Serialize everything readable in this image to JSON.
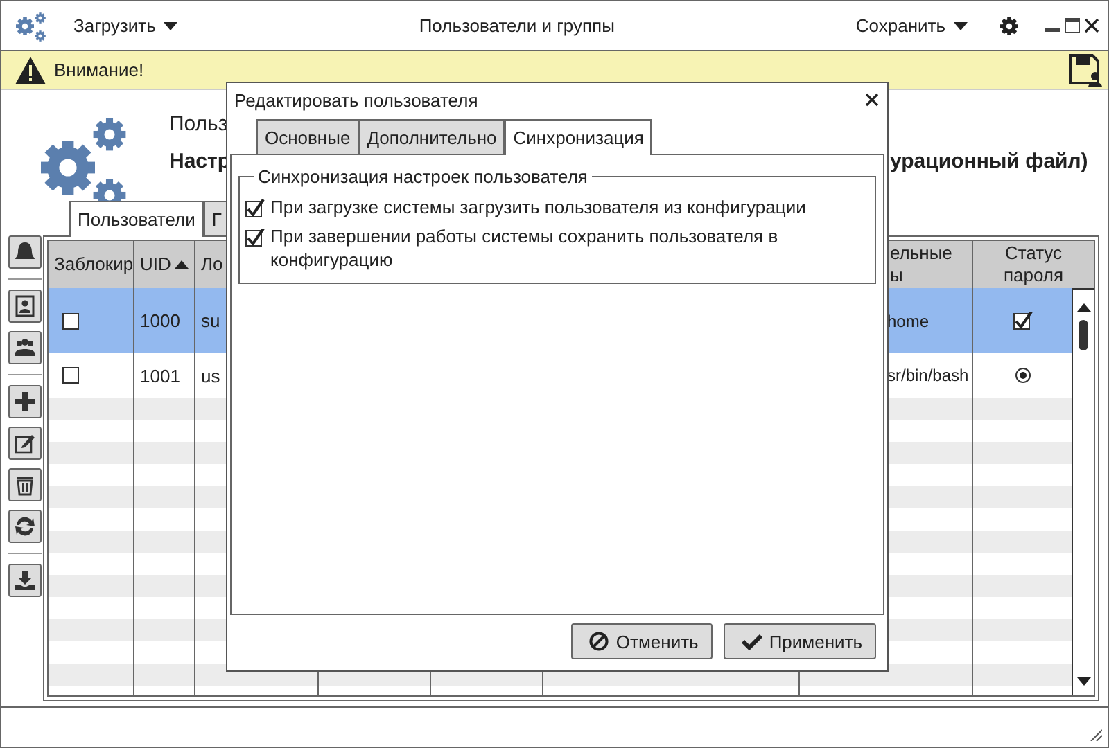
{
  "window": {
    "title": "Пользователи и группы",
    "load_menu": "Загрузить",
    "save_menu": "Сохранить"
  },
  "warning": {
    "text": "Внимание!"
  },
  "header": {
    "title": "Польз",
    "subtitle_start": "Настр",
    "subtitle_end": "урационный файл)"
  },
  "tabs": [
    {
      "label": "Пользователи",
      "selected": true
    },
    {
      "label": "Г",
      "selected": false
    }
  ],
  "table": {
    "columns": [
      {
        "label": "Заблокир"
      },
      {
        "label": "UID",
        "sort_ascending": true
      },
      {
        "label": "Ло"
      },
      {
        "label": "ельные\nы"
      },
      {
        "label": "Статус пароля"
      }
    ],
    "rows": [
      {
        "selected": true,
        "locked": false,
        "uid": "1000",
        "login": "su",
        "column_7": "home",
        "password_status": {
          "kind": "checkbox",
          "checked": true
        }
      },
      {
        "selected": false,
        "locked": false,
        "uid": "1001",
        "login": "us",
        "column_7": "sr/bin/bash",
        "password_status": {
          "kind": "radio",
          "checked": true
        }
      }
    ]
  },
  "dialog": {
    "title": "Редактировать пользователя",
    "tabs": [
      {
        "label": "Основные",
        "selected": false
      },
      {
        "label": "Дополнительно",
        "selected": false
      },
      {
        "label": "Синхронизация",
        "selected": true
      }
    ],
    "group": {
      "title": "Синхронизация настроек пользователя",
      "options": [
        {
          "label": "При загрузке системы загрузить пользователя из конфигурации",
          "checked": true
        },
        {
          "label": "При завершении работы системы сохранить пользователя в конфигурацию",
          "checked": true
        }
      ]
    },
    "buttons": [
      {
        "label": "Отменить",
        "kind": "cancel"
      },
      {
        "label": "Применить",
        "kind": "apply"
      }
    ]
  }
}
